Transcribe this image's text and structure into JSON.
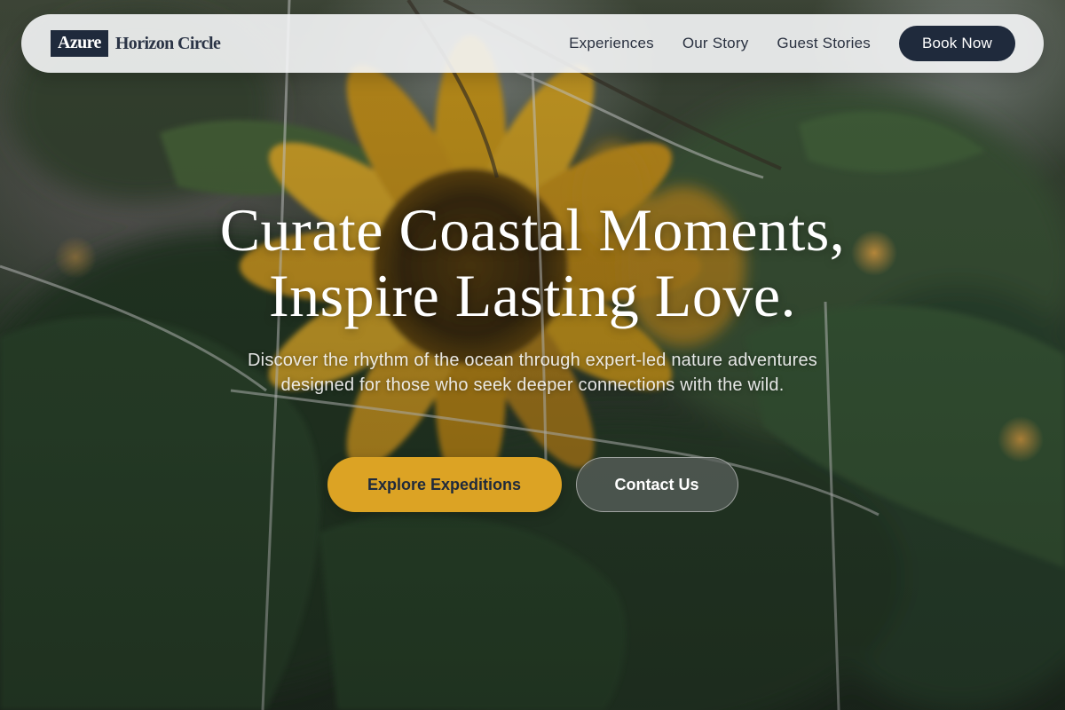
{
  "brand": {
    "highlight": "Azure",
    "rest": "Horizon Circle"
  },
  "nav": {
    "links": [
      "Experiences",
      "Our Story",
      "Guest Stories"
    ],
    "cta": "Book Now"
  },
  "hero": {
    "title_line1": "Curate Coastal Moments,",
    "title_line2": "Inspire Lasting Love.",
    "subtitle": "Discover the rhythm of the ocean through expert-led nature adventures designed for those who seek deeper connections with the wild.",
    "primary_button": "Explore Expeditions",
    "secondary_button": "Contact Us"
  },
  "colors": {
    "navy": "#1f2a3c",
    "gold": "#dca324",
    "nav_bg": "#f5f6f7"
  }
}
